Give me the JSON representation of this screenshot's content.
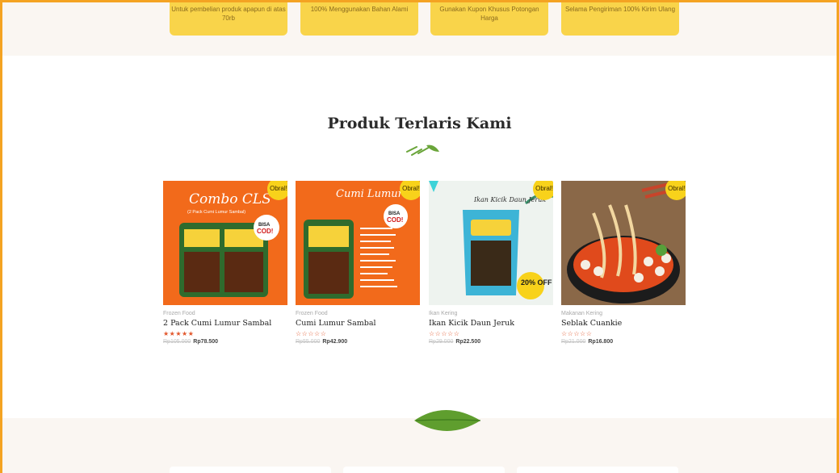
{
  "features": [
    {
      "text": "Untuk pembelian produk apapun di atas 70rb"
    },
    {
      "text": "100% Menggunakan Bahan Alami"
    },
    {
      "text": "Gunakan Kupon Khusus Potongan Harga"
    },
    {
      "text": "Selama Pengiriman 100% Kirim Ulang"
    }
  ],
  "section": {
    "title": "Produk Terlaris Kami"
  },
  "products": [
    {
      "badge": "Obral!",
      "image_text": {
        "headline": "Combo CLS",
        "sub": "(2 Pack Cumi Lumur Sambal)",
        "cod": "BISA COD!"
      },
      "category": "Frozen Food",
      "name": "2 Pack Cumi Lumur Sambal",
      "stars": "★★★★★",
      "rating": 5,
      "old_price": "Rp105.000",
      "price": "Rp78.500"
    },
    {
      "badge": "Obral!",
      "image_text": {
        "headline": "Cumi Lumur Sambal",
        "cod": "BISA COD!"
      },
      "category": "Frozen Food",
      "name": "Cumi Lumur Sambal",
      "stars": "☆☆☆☆☆",
      "rating": 0,
      "old_price": "Rp55.000",
      "price": "Rp42.900"
    },
    {
      "badge": "Obral!",
      "image_text": {
        "headline": "Ikan Kicik Daun Jeruk",
        "discount": "20% OFF"
      },
      "category": "Ikan Kering",
      "name": "Ikan Kicik Daun Jeruk",
      "stars": "☆☆☆☆☆",
      "rating": 0,
      "old_price": "Rp29.000",
      "price": "Rp22.500"
    },
    {
      "badge": "Obral!",
      "image_text": {},
      "category": "Makanan Kering",
      "name": "Seblak Cuankie",
      "stars": "☆☆☆☆☆",
      "rating": 0,
      "old_price": "Rp21.000",
      "price": "Rp16.800"
    }
  ],
  "colors": {
    "accent": "#f4a322",
    "badge": "#f8d21b",
    "feature_bg": "#f9d44a",
    "product_orange": "#f26a1b",
    "star": "#e2562b",
    "leaf": "#6aa53a"
  },
  "icons": {
    "divider": "leaf-divider-icon",
    "bottom": "basil-leaf-icon"
  }
}
